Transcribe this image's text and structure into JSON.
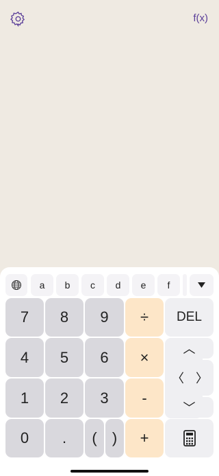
{
  "header": {
    "settings_icon": "gear-icon",
    "function_label": "f(x)"
  },
  "letter_row": {
    "keys": [
      "a",
      "b",
      "c",
      "d",
      "e",
      "f"
    ],
    "globe_icon": "globe-icon",
    "collapse_icon": "triangle-down-icon"
  },
  "keypad": {
    "row1": [
      "7",
      "8",
      "9",
      "÷"
    ],
    "row2": [
      "4",
      "5",
      "6",
      "×"
    ],
    "row3": [
      "1",
      "2",
      "3",
      "-"
    ],
    "row4": [
      "0",
      ".",
      "(",
      ")",
      "+"
    ],
    "del_label": "DEL",
    "calculator_icon": "calculator-icon",
    "nav": {
      "up": "︿",
      "left": "〈",
      "right": "〉",
      "down": "﹀"
    }
  },
  "colors": {
    "background": "#efeae2",
    "accent": "#5b3f99",
    "number_key": "#d9d8dd",
    "operator_key": "#fde6c8",
    "side_key": "#efeff2"
  }
}
